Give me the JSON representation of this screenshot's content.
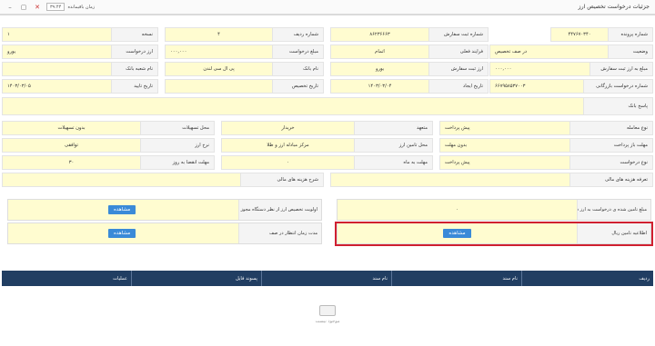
{
  "window": {
    "title": "جزئیات درخواست تخصیص ارز",
    "timer_label": "زمان باقیمانده",
    "timer_value": "۳۹:۴۴"
  },
  "rows": {
    "r1": [
      {
        "label": "شماره پرونده",
        "value": "۴۴۷۶۷۰۳۴۰"
      },
      {
        "label": "شماره ثبت سفارش",
        "value": "۸۶۲۳۶۶۶۳"
      },
      {
        "label": "شماره ردیف",
        "value": "۴"
      },
      {
        "label": "نسخه",
        "value": "۱"
      }
    ],
    "r2": [
      {
        "label": "وضعیت",
        "value": "در صف تخصیص"
      },
      {
        "label": "فرایند فعلی",
        "value": "اتمام"
      },
      {
        "label": "مبلغ درخواست",
        "value": "۰۰۰,۰۰۰"
      },
      {
        "label": "ارز درخواست",
        "value": "یورو"
      }
    ],
    "r3": [
      {
        "label": "مبلغ به ارز ثبت سفارش",
        "value": "۰۰۰,۰۰۰"
      },
      {
        "label": "ارز ثبت سفارش",
        "value": "یورو"
      },
      {
        "label": "نام بانک",
        "value": "پی ال سی لندن"
      },
      {
        "label": "نام شعبه بانک",
        "value": ""
      }
    ],
    "r4": [
      {
        "label": "شماره درخواست بازرگانی",
        "value": "۶۶۷۹۵۸۵۳۷۰۰۳"
      },
      {
        "label": "تاریخ ایجاد",
        "value": "۱۴۰۳/۰۳/۰۴"
      },
      {
        "label": "تاریخ تخصیص",
        "value": ""
      },
      {
        "label": "تاریخ تایید",
        "value": "۱۴۰۳/۰۳/۰۵"
      }
    ]
  },
  "bank_reply": {
    "label": "پاسخ بانک",
    "value": ""
  },
  "section2": {
    "r1": [
      {
        "label": "نوع معامله",
        "value": "پیش پرداخت"
      },
      {
        "label": "متعهد",
        "value": "خریدار"
      },
      {
        "label": "محل تسهیلات",
        "value": "بدون تسهیلات"
      }
    ],
    "r2": [
      {
        "label": "مهلت باز پرداخت",
        "value": "بدون مهلت"
      },
      {
        "label": "محل تامین ارز",
        "value": "مرکز مبادله ارز و طلا"
      },
      {
        "label": "نرخ ارز",
        "value": "توافقی"
      }
    ],
    "r3": [
      {
        "label": "نوع درخواست",
        "value": "پیش پرداخت"
      },
      {
        "label": "مهلت به ماه",
        "value": "۰"
      },
      {
        "label": "مهلت انقضا به روز",
        "value": "۳۰"
      }
    ]
  },
  "fee_tariff": {
    "label": "تعرفه هزینه های مالی",
    "value": ""
  },
  "fee_desc": {
    "label": "شرح هزینه های مالی",
    "value": ""
  },
  "panels": {
    "funded_amount": {
      "label": "مبلغ تامین شده ی درخواست به ارز درخواست",
      "value": "۰"
    },
    "priority": {
      "label": "اولویت تخصیص ارز از نظر دستگاه مجوز دهنده",
      "button": "مشاهده"
    },
    "rial_funding": {
      "label": "اطلاعیه تامین ریال",
      "button": "مشاهده"
    },
    "queue_wait": {
      "label": "مدت زمان انتظار در صف",
      "button": "مشاهده"
    }
  },
  "table": {
    "columns": [
      "ردیف",
      "نام سند",
      "نام سند",
      "پسوند فایل",
      "عملیات"
    ],
    "empty_text": "موجود نیست"
  }
}
